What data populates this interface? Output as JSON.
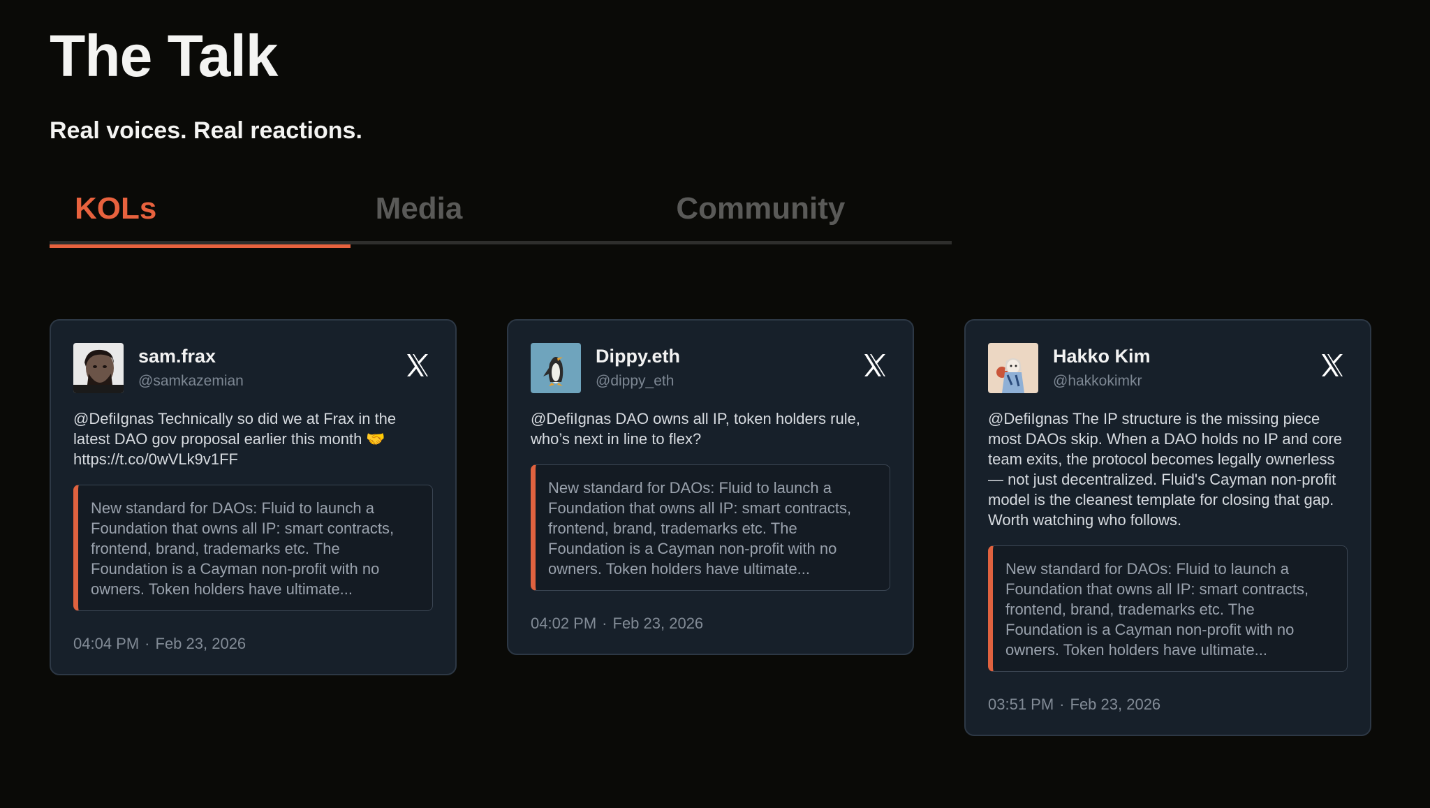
{
  "header": {
    "title": "The Talk",
    "subtitle": "Real voices. Real reactions."
  },
  "tabs": [
    {
      "label": "KOLs",
      "active": true
    },
    {
      "label": "Media",
      "active": false
    },
    {
      "label": "Community",
      "active": false
    }
  ],
  "colors": {
    "accent": "#e8623e",
    "card_bg": "#17202a",
    "page_bg": "#0a0a07"
  },
  "cards": [
    {
      "name": "sam.frax",
      "handle": "@samkazemian",
      "text": "@DefiIgnas Technically so did we at Frax in the latest DAO gov proposal earlier this month 🤝 https://t.co/0wVLk9v1FF",
      "quote": "New standard for DAOs: Fluid to launch a Foundation that owns all IP: smart contracts, frontend, brand, trademarks etc. The Foundation is a Cayman non-profit with no owners. Token holders have ultimate...",
      "time": "04:04 PM",
      "date": "Feb 23, 2026",
      "dot": "·",
      "icon": "x-logo-icon"
    },
    {
      "name": "Dippy.eth",
      "handle": "@dippy_eth",
      "text": "@DefiIgnas DAO owns all IP, token holders rule, who’s next in line to flex?",
      "quote": "New standard for DAOs: Fluid to launch a Foundation that owns all IP: smart contracts, frontend, brand, trademarks etc. The Foundation is a Cayman non-profit with no owners. Token holders have ultimate...",
      "time": "04:02 PM",
      "date": "Feb 23, 2026",
      "dot": "·",
      "icon": "x-logo-icon"
    },
    {
      "name": "Hakko Kim",
      "handle": "@hakkokimkr",
      "text": "@DefiIgnas The IP structure is the missing piece most DAOs skip. When a DAO holds no IP and core team exits, the protocol becomes legally ownerless — not just decentralized. Fluid's Cayman non-profit model is the cleanest template for closing that gap. Worth watching who follows.",
      "quote": "New standard for DAOs: Fluid to launch a Foundation that owns all IP: smart contracts, frontend, brand, trademarks etc. The Foundation is a Cayman non-profit with no owners. Token holders have ultimate...",
      "time": "03:51 PM",
      "date": "Feb 23, 2026",
      "dot": "·",
      "icon": "x-logo-icon"
    }
  ]
}
